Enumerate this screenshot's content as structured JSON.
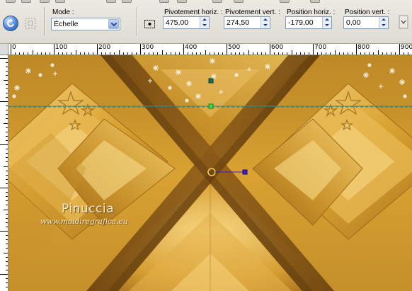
{
  "toolbar": {
    "mode_label": "Mode :",
    "mode_value": "Échelle",
    "pivot_h_label": "Pivotement horiz. :",
    "pivot_h_value": "475,00",
    "pivot_v_label": "Pivotement vert. :",
    "pivot_v_value": "274,50",
    "pos_h_label": "Position horiz. :",
    "pos_h_value": "-179,00",
    "pos_v_label": "Position vert. :",
    "pos_v_value": "0,00"
  },
  "ruler": {
    "labels": [
      "0",
      "100",
      "200",
      "300",
      "400",
      "500",
      "600",
      "700",
      "800",
      "900"
    ]
  },
  "canvas": {
    "watermark_name": "Pinuccia",
    "watermark_url": "www.maidiregrafica.eu"
  },
  "colors": {
    "gold_light": "#f0c35a",
    "gold_mid": "#d9a232",
    "gold_dark": "#8a5a12",
    "band_brown": "#7a4e14",
    "guide_teal": "#2a9a86",
    "handle_green": "#3ddc4c",
    "handle_purple": "#3d1ec4"
  }
}
